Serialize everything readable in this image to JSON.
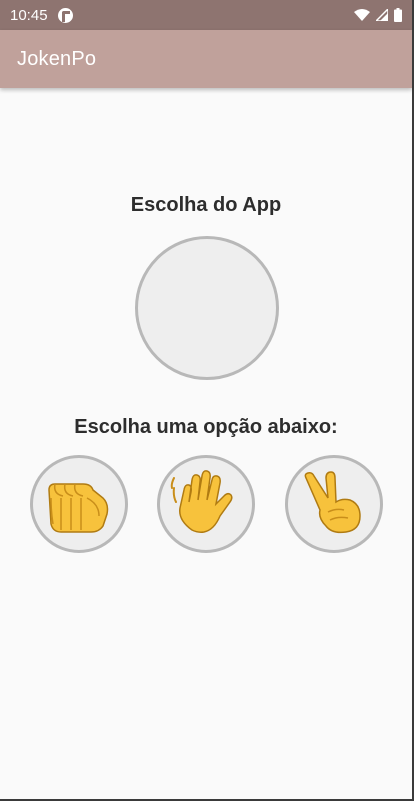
{
  "status_bar": {
    "time": "10:45"
  },
  "app_bar": {
    "title": "JokenPo"
  },
  "main": {
    "app_choice_heading": "Escolha do App",
    "user_choice_heading": "Escolha uma opção abaixo:",
    "options": [
      {
        "id": "pedra",
        "icon": "fist-icon"
      },
      {
        "id": "papel",
        "icon": "open-hand-icon"
      },
      {
        "id": "tesoura",
        "icon": "victory-hand-icon"
      }
    ]
  },
  "colors": {
    "status_bar": "#8e7470",
    "app_bar": "#c0a19b",
    "background": "#fafafa",
    "circle_fill": "#eeeeee",
    "circle_border": "#b8b8b8",
    "emoji_yellow": "#f7c23c"
  }
}
